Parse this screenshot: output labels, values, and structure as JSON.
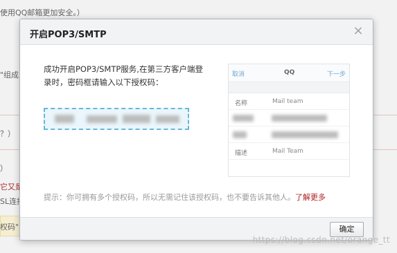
{
  "background": {
    "line1": "使用QQ邮箱更加安全。）",
    "line2": "\"组成",
    "line3": "？）",
    "line4": "）",
    "line5": "它又是",
    "line6": "SL连接",
    "line7": "权码\""
  },
  "dialog": {
    "title": "开启POP3/SMTP",
    "close_icon": "close-icon",
    "message": "成功开启POP3/SMTP服务,在第三方客户端登录时，密码框请输入以下授权码：",
    "auth_code_hint": "authorization code (blurred)",
    "phone": {
      "cancel": "取消",
      "title": "QQ",
      "next": "下一步",
      "rows": [
        {
          "label": "名称",
          "value": "Mail team"
        },
        {
          "label": "",
          "value": ""
        },
        {
          "label": "",
          "value": ""
        },
        {
          "label": "描述",
          "value": "Mail Team"
        }
      ]
    },
    "tip_text": "提示：你可拥有多个授权码，所以无需记住该授权码，也不要告诉其他人。",
    "learn_more": "了解更多",
    "confirm": "确定"
  },
  "watermark": "https://blog.csdn.net/orange_tt",
  "colors": {
    "link_red": "#b02020",
    "dash_blue": "#6ab6d9",
    "nav_blue": "#6fa7d8"
  }
}
